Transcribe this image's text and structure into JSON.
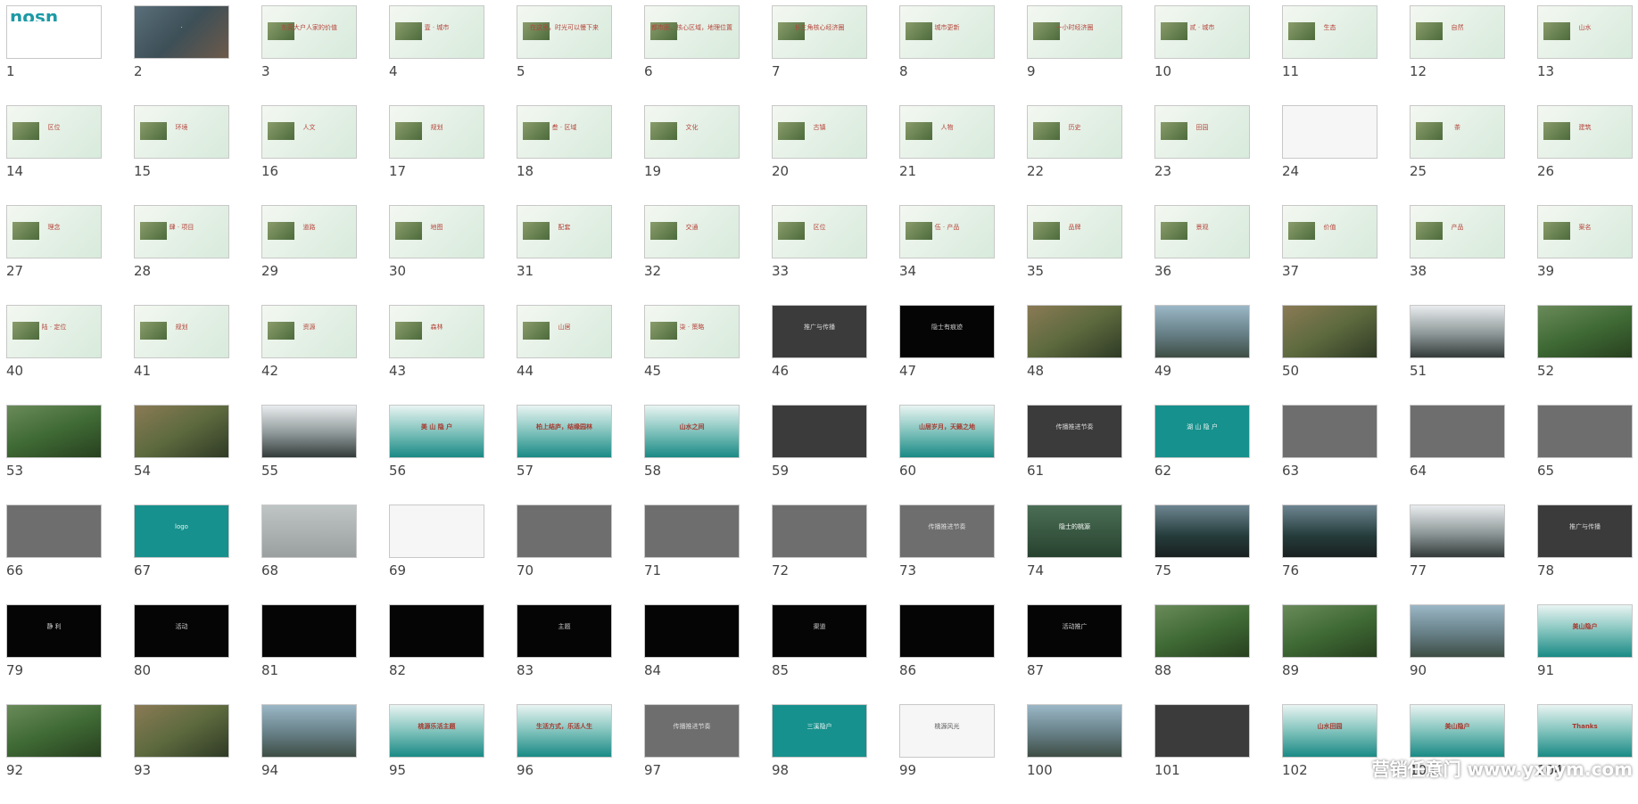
{
  "watermark": "营销任意门 www.yxrym.com",
  "slides": [
    {
      "n": "1",
      "t": "first",
      "title": "hosn"
    },
    {
      "n": "2",
      "t": "map",
      "title": "·"
    },
    {
      "n": "3",
      "t": "light",
      "title": "东莞大户人家的价值"
    },
    {
      "n": "4",
      "t": "light",
      "title": "壹 · 城市"
    },
    {
      "n": "5",
      "t": "light",
      "title": "在这里，时光可以慢下来"
    },
    {
      "n": "6",
      "t": "light",
      "title": "都市圈，核心区域，地理位置"
    },
    {
      "n": "7",
      "t": "light",
      "title": "长三角核心经济圈"
    },
    {
      "n": "8",
      "t": "light",
      "title": "城市更新"
    },
    {
      "n": "9",
      "t": "light",
      "title": "一小时经济圈"
    },
    {
      "n": "10",
      "t": "light",
      "title": "贰 · 城市"
    },
    {
      "n": "11",
      "t": "light",
      "title": "生态"
    },
    {
      "n": "12",
      "t": "light",
      "title": "自然"
    },
    {
      "n": "13",
      "t": "light",
      "title": "山水"
    },
    {
      "n": "14",
      "t": "light",
      "title": "区位"
    },
    {
      "n": "15",
      "t": "light",
      "title": "环境"
    },
    {
      "n": "16",
      "t": "light",
      "title": "人文"
    },
    {
      "n": "17",
      "t": "light",
      "title": "规划"
    },
    {
      "n": "18",
      "t": "light",
      "title": "叁 · 区域"
    },
    {
      "n": "19",
      "t": "light",
      "title": "文化"
    },
    {
      "n": "20",
      "t": "light",
      "title": "古镇"
    },
    {
      "n": "21",
      "t": "light",
      "title": "人物"
    },
    {
      "n": "22",
      "t": "light",
      "title": "历史"
    },
    {
      "n": "23",
      "t": "light",
      "title": "田园"
    },
    {
      "n": "24",
      "t": "white",
      "title": ""
    },
    {
      "n": "25",
      "t": "light",
      "title": "茶"
    },
    {
      "n": "26",
      "t": "light",
      "title": "建筑"
    },
    {
      "n": "27",
      "t": "light",
      "title": "理念"
    },
    {
      "n": "28",
      "t": "light",
      "title": "肆 · 项目"
    },
    {
      "n": "29",
      "t": "light",
      "title": "道路"
    },
    {
      "n": "30",
      "t": "light",
      "title": "地图"
    },
    {
      "n": "31",
      "t": "light",
      "title": "配套"
    },
    {
      "n": "32",
      "t": "light",
      "title": "交通"
    },
    {
      "n": "33",
      "t": "light",
      "title": "区位"
    },
    {
      "n": "34",
      "t": "light",
      "title": "伍 · 产品"
    },
    {
      "n": "35",
      "t": "light",
      "title": "品牌"
    },
    {
      "n": "36",
      "t": "light",
      "title": "景观"
    },
    {
      "n": "37",
      "t": "light",
      "title": "价值"
    },
    {
      "n": "38",
      "t": "light",
      "title": "产品"
    },
    {
      "n": "39",
      "t": "light",
      "title": "案名"
    },
    {
      "n": "40",
      "t": "light",
      "title": "陆 · 定位"
    },
    {
      "n": "41",
      "t": "light",
      "title": "规划"
    },
    {
      "n": "42",
      "t": "light",
      "title": "资源"
    },
    {
      "n": "43",
      "t": "light",
      "title": "森林"
    },
    {
      "n": "44",
      "t": "light",
      "title": "山居"
    },
    {
      "n": "45",
      "t": "light",
      "title": "柒 · 策略"
    },
    {
      "n": "46",
      "t": "dark",
      "title": "推广与传播"
    },
    {
      "n": "47",
      "t": "black",
      "title": "隐士有痕迹"
    },
    {
      "n": "48",
      "t": "photo-brown",
      "title": ""
    },
    {
      "n": "49",
      "t": "photo-blue",
      "title": ""
    },
    {
      "n": "50",
      "t": "photo-brown",
      "title": ""
    },
    {
      "n": "51",
      "t": "mist",
      "title": ""
    },
    {
      "n": "52",
      "t": "photo-green",
      "title": ""
    },
    {
      "n": "53",
      "t": "photo-green",
      "title": ""
    },
    {
      "n": "54",
      "t": "photo-brown",
      "title": ""
    },
    {
      "n": "55",
      "t": "mist",
      "title": ""
    },
    {
      "n": "56",
      "t": "tealgrad",
      "title": "美 山 隐 户"
    },
    {
      "n": "57",
      "t": "tealgrad",
      "title": "柏上结庐，结缘园林"
    },
    {
      "n": "58",
      "t": "tealgrad",
      "title": "山水之间"
    },
    {
      "n": "59",
      "t": "dark",
      "title": ""
    },
    {
      "n": "60",
      "t": "tealgrad",
      "title": "山居岁月，天籁之地"
    },
    {
      "n": "61",
      "t": "dark",
      "title": "传播推进节奏"
    },
    {
      "n": "62",
      "t": "teal",
      "title": "湖 山 隐 户"
    },
    {
      "n": "63",
      "t": "gray",
      "title": ""
    },
    {
      "n": "64",
      "t": "gray",
      "title": ""
    },
    {
      "n": "65",
      "t": "gray",
      "title": ""
    },
    {
      "n": "66",
      "t": "gray",
      "title": ""
    },
    {
      "n": "67",
      "t": "teal",
      "title": "logo"
    },
    {
      "n": "68",
      "t": "fabric",
      "title": ""
    },
    {
      "n": "69",
      "t": "white",
      "title": ""
    },
    {
      "n": "70",
      "t": "gray",
      "title": ""
    },
    {
      "n": "71",
      "t": "gray",
      "title": ""
    },
    {
      "n": "72",
      "t": "gray",
      "title": ""
    },
    {
      "n": "73",
      "t": "gray",
      "title": "传播推进节奏"
    },
    {
      "n": "74",
      "t": "pine",
      "title": "隐士的桃源"
    },
    {
      "n": "75",
      "t": "billboard",
      "title": ""
    },
    {
      "n": "76",
      "t": "billboard",
      "title": ""
    },
    {
      "n": "77",
      "t": "mist",
      "title": ""
    },
    {
      "n": "78",
      "t": "dark",
      "title": "推广与传播"
    },
    {
      "n": "79",
      "t": "black",
      "title": "静 利"
    },
    {
      "n": "80",
      "t": "black",
      "title": "活动"
    },
    {
      "n": "81",
      "t": "black",
      "title": ""
    },
    {
      "n": "82",
      "t": "black",
      "title": ""
    },
    {
      "n": "83",
      "t": "black",
      "title": "主题"
    },
    {
      "n": "84",
      "t": "black",
      "title": ""
    },
    {
      "n": "85",
      "t": "black",
      "title": "渠道"
    },
    {
      "n": "86",
      "t": "black",
      "title": ""
    },
    {
      "n": "87",
      "t": "black",
      "title": "活动推广"
    },
    {
      "n": "88",
      "t": "photo-green",
      "title": ""
    },
    {
      "n": "89",
      "t": "photo-green",
      "title": ""
    },
    {
      "n": "90",
      "t": "photo-blue",
      "title": ""
    },
    {
      "n": "91",
      "t": "tealgrad",
      "title": "美山隐户"
    },
    {
      "n": "92",
      "t": "photo-green",
      "title": ""
    },
    {
      "n": "93",
      "t": "photo-brown",
      "title": ""
    },
    {
      "n": "94",
      "t": "photo-blue",
      "title": ""
    },
    {
      "n": "95",
      "t": "tealgrad",
      "title": "桃源乐活主题"
    },
    {
      "n": "96",
      "t": "tealgrad",
      "title": "生活方式，乐活人生"
    },
    {
      "n": "97",
      "t": "gray",
      "title": "传播推进节奏"
    },
    {
      "n": "98",
      "t": "teal",
      "title": "三溪隐户"
    },
    {
      "n": "99",
      "t": "white",
      "title": "桃源风光"
    },
    {
      "n": "100",
      "t": "photo-blue",
      "title": ""
    },
    {
      "n": "101",
      "t": "dark",
      "title": ""
    },
    {
      "n": "102",
      "t": "tealgrad",
      "title": "山水田园"
    },
    {
      "n": "103",
      "t": "tealgrad",
      "title": "美山隐户"
    },
    {
      "n": "104",
      "t": "tealgrad",
      "title": "Thanks"
    }
  ]
}
